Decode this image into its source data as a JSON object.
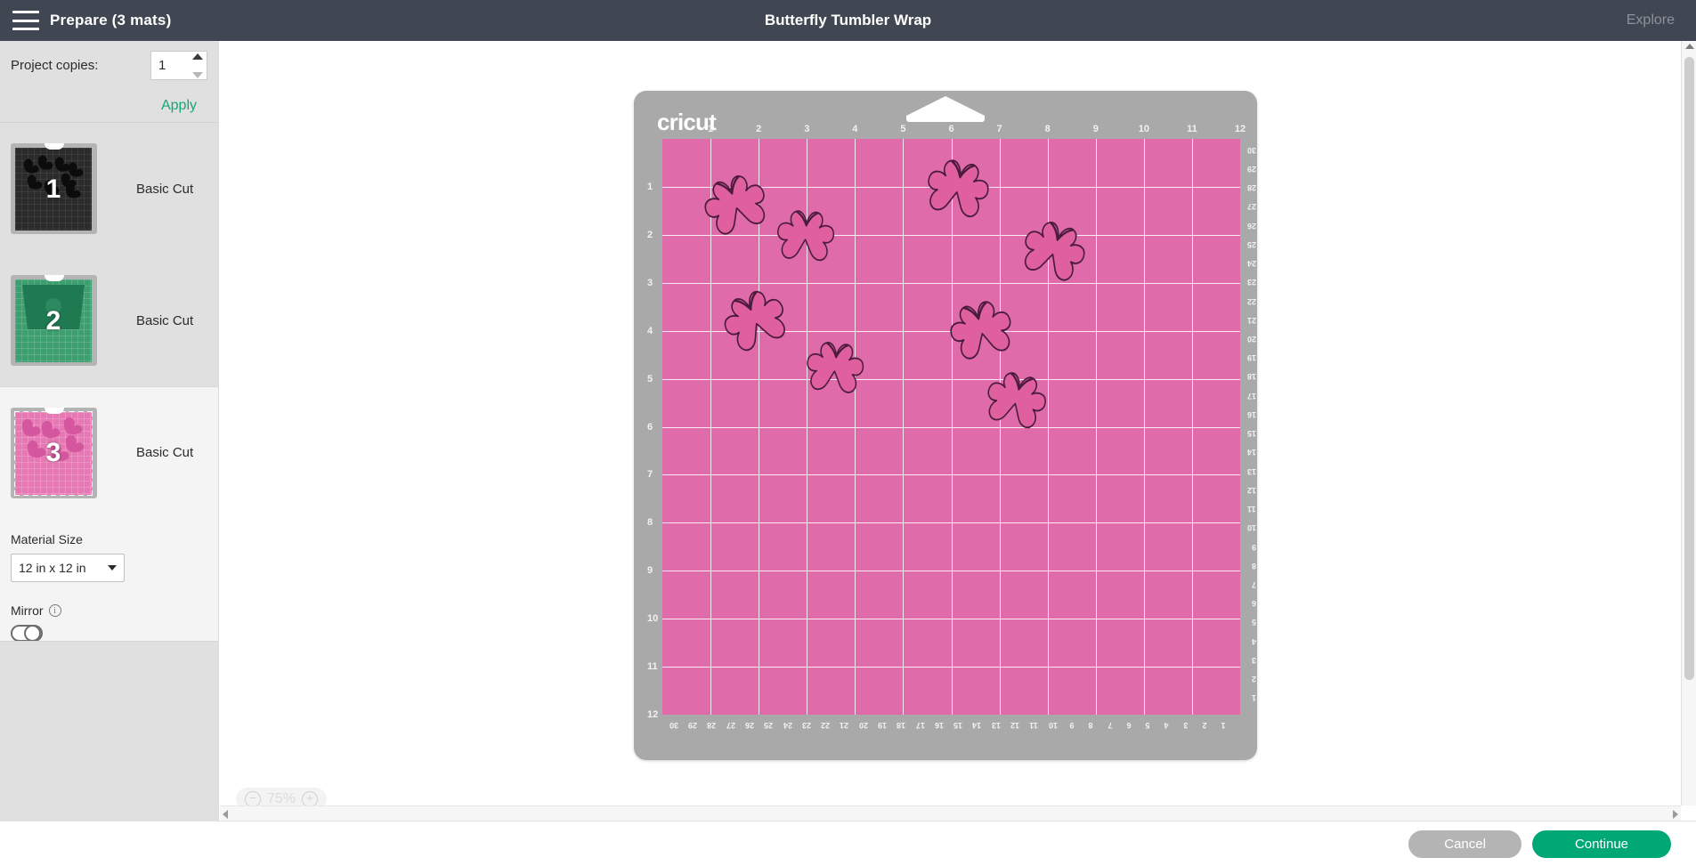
{
  "topbar": {
    "menu_icon": "hamburger-icon",
    "left_title": "Prepare (3 mats)",
    "center_title": "Butterfly Tumbler Wrap",
    "right_label": "Explore"
  },
  "left_panel": {
    "copies_label": "Project copies:",
    "copies_value": "1",
    "apply_label": "Apply",
    "mats": [
      {
        "number": "1",
        "label": "Basic Cut",
        "material_color": "#2b2b2b",
        "shape_color": "#111111",
        "selected": false
      },
      {
        "number": "2",
        "label": "Basic Cut",
        "material_color": "#3d9e6f",
        "shape_color": "#2a7d56",
        "selected": false
      },
      {
        "number": "3",
        "label": "Basic Cut",
        "material_color": "#e678b4",
        "shape_color": "#d4569e",
        "selected": true
      }
    ],
    "material_size_label": "Material Size",
    "material_size_value": "12 in x 12 in",
    "material_size_options": [
      "12 in x 12 in"
    ],
    "mirror_label": "Mirror",
    "mirror_info_icon": "info-icon",
    "mirror_enabled": false
  },
  "canvas": {
    "mat_brand": "cricut",
    "mat_fill_color": "#e06bab",
    "mat_frame_color": "#a9a9a9",
    "shape_fill_color": "#e0609f",
    "shape_stroke_color": "#4a1b3d",
    "ruler_inches_top": [
      "1",
      "2",
      "3",
      "4",
      "5",
      "6",
      "7",
      "8",
      "9",
      "10",
      "11",
      "12"
    ],
    "ruler_inches_left": [
      "1",
      "2",
      "3",
      "4",
      "5",
      "6",
      "7",
      "8",
      "9",
      "10",
      "11",
      "12"
    ],
    "ruler_cm_right": [
      "30",
      "29",
      "28",
      "27",
      "26",
      "25",
      "24",
      "23",
      "22",
      "21",
      "20",
      "19",
      "18",
      "17",
      "16",
      "15",
      "14",
      "13",
      "12",
      "11",
      "10",
      "9",
      "8",
      "7",
      "6",
      "5",
      "4",
      "3",
      "2",
      "1"
    ],
    "ruler_cm_bottom": [
      "30",
      "29",
      "28",
      "27",
      "26",
      "25",
      "24",
      "23",
      "22",
      "21",
      "20",
      "19",
      "18",
      "17",
      "16",
      "15",
      "14",
      "13",
      "12",
      "11",
      "10",
      "9",
      "8",
      "7",
      "6",
      "5",
      "4",
      "3",
      "2",
      "1"
    ],
    "shapes": [
      {
        "name": "butterfly",
        "x_in": 0.85,
        "y_in": 0.75,
        "size_in": 1.35,
        "rotation": -18
      },
      {
        "name": "butterfly",
        "x_in": 2.35,
        "y_in": 1.45,
        "size_in": 1.25,
        "rotation": 4
      },
      {
        "name": "butterfly",
        "x_in": 5.45,
        "y_in": 0.4,
        "size_in": 1.35,
        "rotation": 12
      },
      {
        "name": "butterfly",
        "x_in": 7.45,
        "y_in": 1.7,
        "size_in": 1.35,
        "rotation": 18
      },
      {
        "name": "butterfly",
        "x_in": 1.25,
        "y_in": 3.15,
        "size_in": 1.35,
        "rotation": -22
      },
      {
        "name": "butterfly",
        "x_in": 5.95,
        "y_in": 3.35,
        "size_in": 1.35,
        "rotation": -14
      },
      {
        "name": "butterfly",
        "x_in": 2.95,
        "y_in": 4.2,
        "size_in": 1.25,
        "rotation": 6
      },
      {
        "name": "butterfly",
        "x_in": 6.7,
        "y_in": 4.85,
        "size_in": 1.3,
        "rotation": 14
      }
    ],
    "zoom_level": "75%",
    "zoom_out_icon": "minus-circle-icon",
    "zoom_in_icon": "plus-circle-icon"
  },
  "bottombar": {
    "cancel_label": "Cancel",
    "continue_label": "Continue",
    "cancel_color": "#b4b4b4",
    "continue_color": "#00a875"
  }
}
